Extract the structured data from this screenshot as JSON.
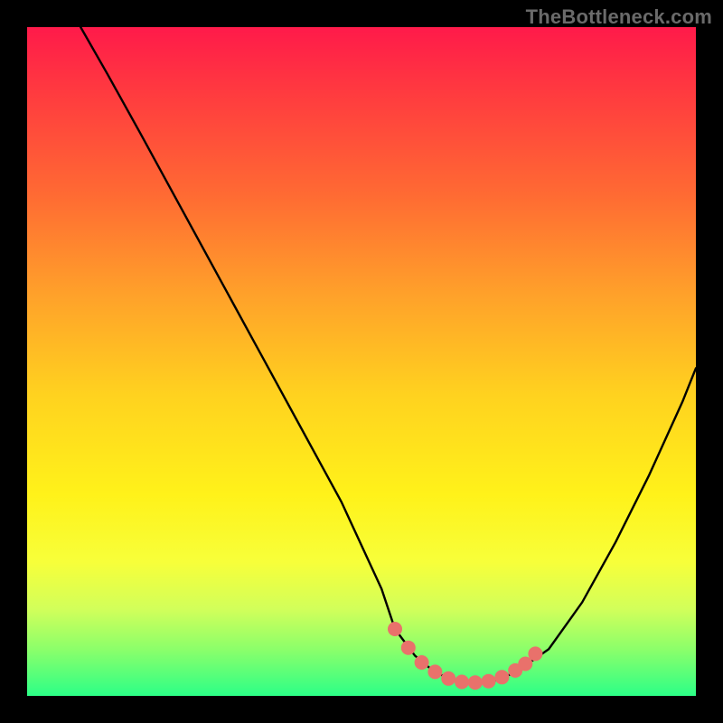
{
  "watermark": "TheBottleneck.com",
  "chart_data": {
    "type": "line",
    "title": "",
    "xlabel": "",
    "ylabel": "",
    "xlim": [
      0,
      100
    ],
    "ylim": [
      0,
      100
    ],
    "series": [
      {
        "name": "bottleneck-curve",
        "x": [
          8,
          12,
          17,
          23,
          29,
          35,
          41,
          47,
          53,
          55,
          58,
          61,
          64,
          67,
          70,
          73,
          78,
          83,
          88,
          93,
          98,
          100
        ],
        "y": [
          100,
          93,
          84,
          73,
          62,
          51,
          40,
          29,
          16,
          10,
          6,
          3.5,
          2.3,
          2.0,
          2.3,
          3.5,
          7,
          14,
          23,
          33,
          44,
          49
        ]
      },
      {
        "name": "highlight-dots",
        "x": [
          55,
          57,
          59,
          61,
          63,
          65,
          67,
          69,
          71,
          73,
          74.5,
          76
        ],
        "y": [
          10,
          7.2,
          5.0,
          3.6,
          2.6,
          2.1,
          2.0,
          2.2,
          2.8,
          3.8,
          4.8,
          6.3
        ]
      }
    ],
    "colors": {
      "curve": "#000000",
      "dots": "#e9716b"
    }
  }
}
